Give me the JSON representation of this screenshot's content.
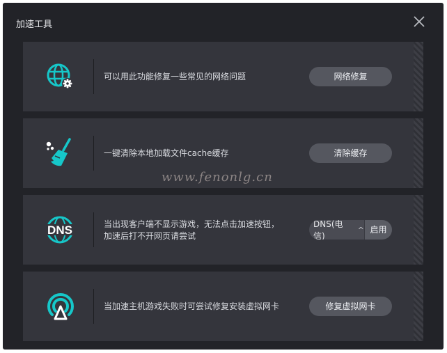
{
  "window": {
    "title": "加速工具"
  },
  "colors": {
    "accent": "#16c7c9",
    "background": "#222328",
    "card": "#34353c",
    "button": "#55575f"
  },
  "tools": [
    {
      "icon": "globe-gear-icon",
      "description": "可以用此功能修复一些常见的网络问题",
      "button_label": "网络修复"
    },
    {
      "icon": "broom-icon",
      "description": "一键清除本地加载文件cache缓存",
      "button_label": "清除缓存"
    },
    {
      "icon": "dns-globe-icon",
      "description_line1": "当出现客户端不显示游戏，无法点击加速按钮，",
      "description_line2": "加速后打不开网页请尝试",
      "select_value": "DNS(电信)",
      "button_label": "启用",
      "icon_text": "DNS"
    },
    {
      "icon": "broadcast-icon",
      "description": "当加速主机游戏失败时可尝试修复安装虚拟网卡",
      "button_label": "修复虚拟网卡"
    }
  ],
  "watermark": "www.fenonlg.cn"
}
